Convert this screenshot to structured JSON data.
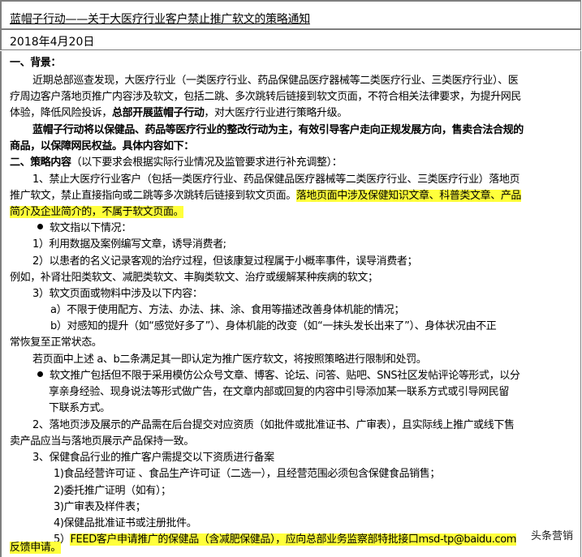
{
  "document": {
    "title": "蓝帽子行动——关于大医疗行业客户禁止推广软文的策略通知",
    "date": "2018年4月20日"
  },
  "content": {
    "s1_heading": "一、背景：",
    "p1_l1": "近期总部巡查发现，大医疗行业（一类医疗行业、药品保健品医疗器械等二类医疗行业、三类医疗行业）、医",
    "p1_l2": "疗周边客户落地页推广内容涉及软文，包括二跳、多次跳转后链接到软文页面，不符合相关法律要求，为提升网民",
    "p1_l3a": "体验，降低风险投诉，",
    "p1_l3b": "总部开展蓝帽子行动",
    "p1_l3c": "，对大医疗行业进行策略升级。",
    "p2_l1": "蓝帽子行动将以保健品、药品等医疗行业的整改行动为主，有效引导客户走向正规发展方向，售卖合法合规的",
    "p2_l2": "商品，以保障网民权益。具体内容如下：",
    "s2_heading_a": "二、策略内容",
    "s2_heading_b": "（以下要求会根据实际行业情况及监管要求进行补充调整）：",
    "r1_l1": "1、禁止大医疗行业客户（包括一类医疗行业、药品保健品医疗器械等二类医疗行业、三类医疗行业）落地页",
    "r1_l2a": "推广软文，禁止直接指向或二跳等多次跳转后链接到软文页面。",
    "r1_l2b": "落地页面中涉及保健知识文章、科普类文章、产品",
    "r1_l3": "简介及企业简介的，不属于软文页面。",
    "b1": "软文指以下情况：",
    "b1_i1": "1）利用数据及案例编写文章，诱导消费者;",
    "b1_i2": "2）以患者的名义记录客观的治疗过程，但该康复过程属于小概率事件，误导消费者；",
    "b1_i2b": "例如，补肾壮阳类软文、减肥类软文、丰胸类软文、治疗或缓解某种疾病的软文；",
    "b1_i3": "3）软文页面或物料中涉及以下内容：",
    "b1_i3a": "a）不限于使用配方、方法、办法、抹、涂、食用等描述改善身体机能的情况；",
    "b1_i3b": "b）对感知的提升（如“感觉好多了”）、身体机能的改变（如“一抹头发长出来了”）、身体状况由不正",
    "b1_i3c": "常恢复至正常状态。",
    "b1_note": "若页面中上述 a、b二条满足其一即认定为推广医疗软文，将按照策略进行限制和处罚。",
    "b2_l1": "软文推广包括但不限于采用模仿公众号文章、博客、论坛、问答、贴吧、SNS社区发帖评论等形式，以分",
    "b2_l2": "享亲身经验、现身说法等形式做广告，在文章内部或回复的内容中引导添加某一联系方式或引导网民留",
    "b2_l3": "下联系方式。",
    "r2_l1": "2、落地页涉及展示的产品需在后台提交对应资质（如批件或批准证书、广审表），且实际线上推广或线下售",
    "r2_l2": "卖产品应当与落地页展示产品保持一致。",
    "r3_l1": "3、保健食品行业的推广客户需提交以下资质进行备案",
    "r3_i1": "1)食品经营许可证 、食品生产许可证（二选一），且经营范围必须包含保健食品销售；",
    "r3_i2": "2)委托推广证明（如有）；",
    "r3_i3": "3)广审表及样件表；",
    "r3_i4": "4)保健品批准证书或注册批件。",
    "r3_i5a": "5）",
    "r3_i5b": "FEED客户申请推广的保健品（含减肥保健品），应向总部业务监察部特批接口msd-tp@baidu.com",
    "r3_i5c": "反馈申请。"
  },
  "watermark": "头条营销",
  "colors": {
    "highlight": "#ffff3b",
    "border": "#7f7f7f"
  }
}
